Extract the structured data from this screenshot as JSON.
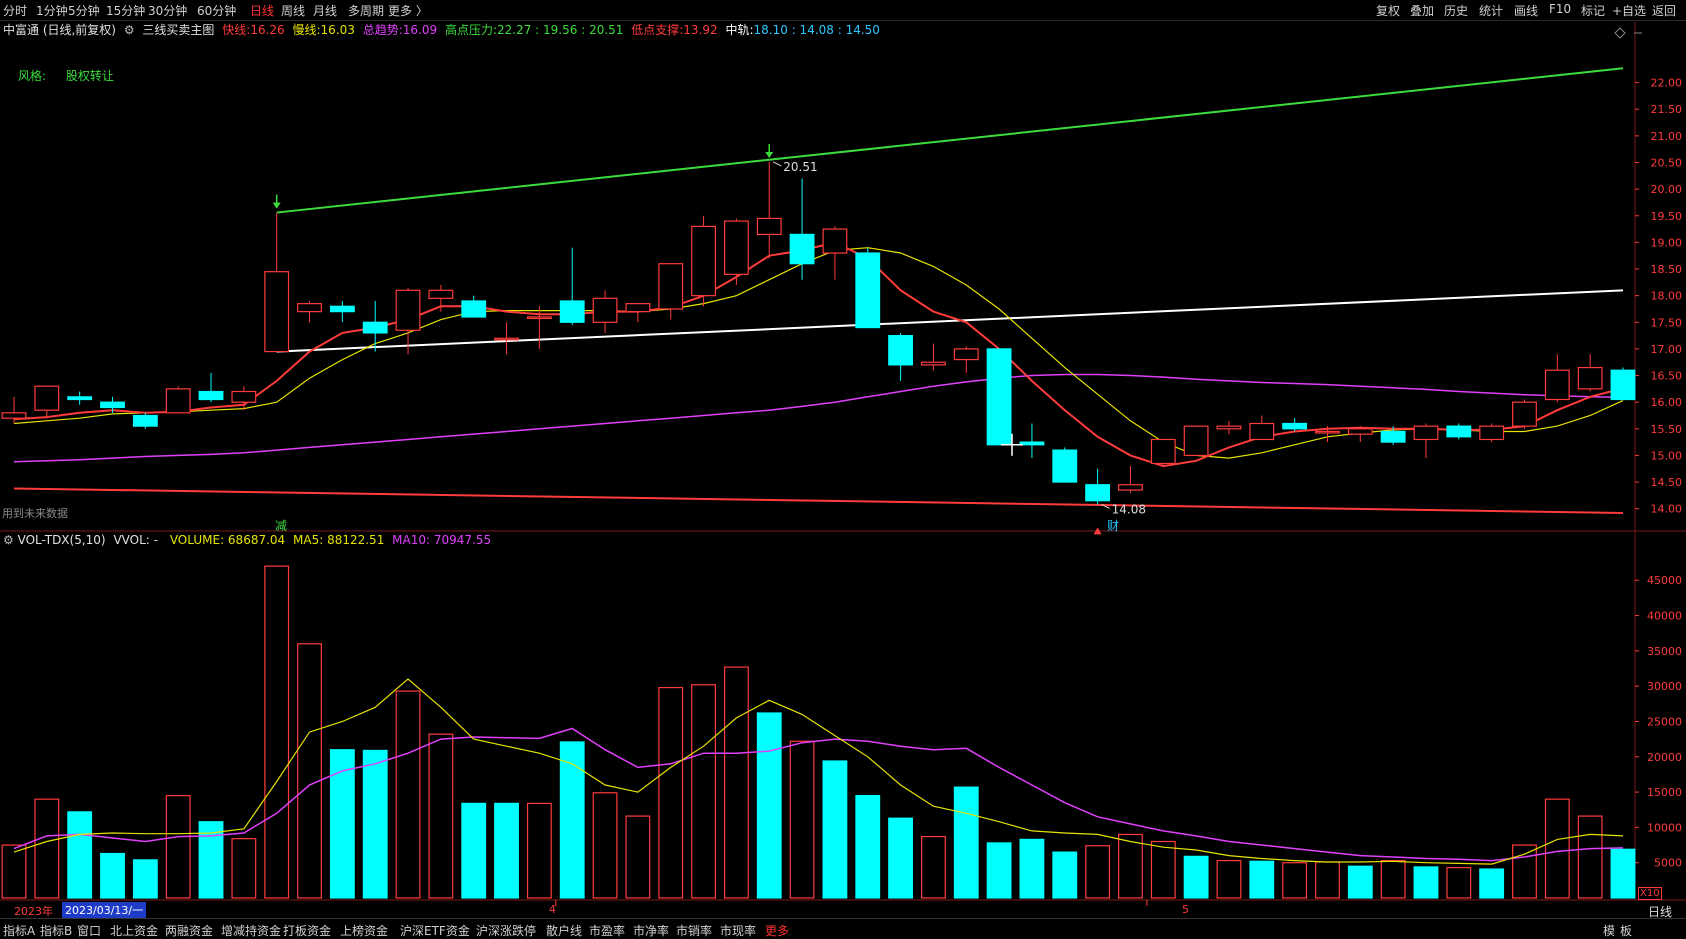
{
  "colors": {
    "up": "#ff3b3b",
    "down": "#00ffff",
    "yellow": "#e5e300",
    "magenta": "#e040fb",
    "green": "#3ddc3d",
    "white": "#ffffff",
    "axis": "#ff3b3b"
  },
  "topbar": {
    "left_tabs": [
      "分时",
      "1分钟",
      "5分钟",
      "15分钟",
      "30分钟",
      "60分钟",
      "日线",
      "周线",
      "月线",
      "多周期",
      "更多 〉"
    ],
    "active_tab": "日线",
    "right_tabs": [
      "复权",
      "叠加",
      "历史",
      "统计",
      "画线",
      "F10",
      "标记",
      "+自选",
      "返回"
    ]
  },
  "infobar": {
    "stock": "中富通 (日线,前复权)",
    "indicator": "三线买卖主图",
    "fast_label": "快线:",
    "fast_value": "16.26",
    "slow_label": "慢线:",
    "slow_value": "16.03",
    "trend_label": "总趋势:",
    "trend_value": "16.09",
    "high_label": "高点压力:",
    "high_values": "22.27 : 19.56 : 20.51",
    "low_label": "低点支撑:",
    "low_value": "13.92",
    "mid_label": "中轨:",
    "mid_values": "18.10 : 14.08 : 14.50"
  },
  "annotations": {
    "style_label": "风格:",
    "style_value": "股权转让",
    "future_data": "用到未来数据",
    "high_mark": "20.51",
    "low_mark": "14.08",
    "event_reduce": "减",
    "event_fin": "财"
  },
  "volbar": {
    "name": "VOL-TDX(5,10)",
    "vvol": "VVOL: -",
    "volume": "VOLUME: 68687.04",
    "ma5": "MA5: 88122.51",
    "ma10": "MA10: 70947.55",
    "multiplier": "X10"
  },
  "datebar": {
    "year": "2023年",
    "date": "2023/03/13/一",
    "m4": "4",
    "m5": "5",
    "period": "日线"
  },
  "bottombar": {
    "tabs": [
      "指标A",
      "指标B",
      "窗口",
      "北上资金",
      "两融资金",
      "增减持资金",
      "打板资金",
      "上榜资金",
      "沪深ETF资金",
      "沪深涨跌停",
      "散户线",
      "市盈率",
      "市净率",
      "市销率",
      "市现率",
      "更多"
    ],
    "active_tab": "更多",
    "right": [
      "模",
      "板"
    ]
  },
  "chart_data": [
    {
      "type": "candlestick",
      "title": "三线买卖主图",
      "ylim": [
        13.6,
        22.8
      ],
      "yticks": [
        14.0,
        14.5,
        15.0,
        15.5,
        16.0,
        16.5,
        17.0,
        17.5,
        18.0,
        18.5,
        19.0,
        19.5,
        20.0,
        20.5,
        21.0,
        21.5,
        22.0
      ],
      "candles": [
        {
          "o": 15.7,
          "h": 16.1,
          "l": 15.6,
          "c": 15.8
        },
        {
          "o": 15.85,
          "h": 16.3,
          "l": 15.7,
          "c": 16.3
        },
        {
          "o": 16.1,
          "h": 16.2,
          "l": 15.95,
          "c": 16.05
        },
        {
          "o": 16.0,
          "h": 16.1,
          "l": 15.8,
          "c": 15.9
        },
        {
          "o": 15.75,
          "h": 15.8,
          "l": 15.5,
          "c": 15.55
        },
        {
          "o": 15.8,
          "h": 16.3,
          "l": 15.8,
          "c": 16.25
        },
        {
          "o": 16.2,
          "h": 16.55,
          "l": 16.0,
          "c": 16.05
        },
        {
          "o": 16.0,
          "h": 16.3,
          "l": 15.85,
          "c": 16.2
        },
        {
          "o": 16.95,
          "h": 19.56,
          "l": 16.95,
          "c": 18.45
        },
        {
          "o": 17.7,
          "h": 17.9,
          "l": 17.5,
          "c": 17.85
        },
        {
          "o": 17.8,
          "h": 17.9,
          "l": 17.5,
          "c": 17.7
        },
        {
          "o": 17.5,
          "h": 17.9,
          "l": 16.95,
          "c": 17.3
        },
        {
          "o": 17.35,
          "h": 18.15,
          "l": 16.9,
          "c": 18.1
        },
        {
          "o": 17.95,
          "h": 18.2,
          "l": 17.7,
          "c": 18.1
        },
        {
          "o": 17.9,
          "h": 18.0,
          "l": 17.6,
          "c": 17.6
        },
        {
          "o": 17.2,
          "h": 17.5,
          "l": 16.9,
          "c": 17.2
        },
        {
          "o": 17.6,
          "h": 17.8,
          "l": 17.0,
          "c": 17.6
        },
        {
          "o": 17.9,
          "h": 18.9,
          "l": 17.45,
          "c": 17.5
        },
        {
          "o": 17.5,
          "h": 18.1,
          "l": 17.3,
          "c": 17.95
        },
        {
          "o": 17.7,
          "h": 17.85,
          "l": 17.5,
          "c": 17.85
        },
        {
          "o": 17.75,
          "h": 18.6,
          "l": 17.55,
          "c": 18.6
        },
        {
          "o": 18.0,
          "h": 19.5,
          "l": 17.8,
          "c": 19.3
        },
        {
          "o": 18.4,
          "h": 19.45,
          "l": 18.2,
          "c": 19.4
        },
        {
          "o": 19.15,
          "h": 20.51,
          "l": 18.7,
          "c": 19.45
        },
        {
          "o": 19.15,
          "h": 20.2,
          "l": 18.3,
          "c": 18.6
        },
        {
          "o": 18.8,
          "h": 19.3,
          "l": 18.3,
          "c": 19.25
        },
        {
          "o": 18.8,
          "h": 18.9,
          "l": 17.4,
          "c": 17.4
        },
        {
          "o": 17.25,
          "h": 17.3,
          "l": 16.4,
          "c": 16.7
        },
        {
          "o": 16.7,
          "h": 17.1,
          "l": 16.6,
          "c": 16.75
        },
        {
          "o": 16.8,
          "h": 17.05,
          "l": 16.55,
          "c": 17.0
        },
        {
          "o": 17.0,
          "h": 17.0,
          "l": 15.2,
          "c": 15.2
        },
        {
          "o": 15.25,
          "h": 15.6,
          "l": 14.95,
          "c": 15.2
        },
        {
          "o": 15.1,
          "h": 15.15,
          "l": 14.5,
          "c": 14.5
        },
        {
          "o": 14.45,
          "h": 14.75,
          "l": 14.08,
          "c": 14.15
        },
        {
          "o": 14.35,
          "h": 14.8,
          "l": 14.3,
          "c": 14.45
        },
        {
          "o": 14.85,
          "h": 15.3,
          "l": 14.8,
          "c": 15.3
        },
        {
          "o": 15.0,
          "h": 15.55,
          "l": 15.0,
          "c": 15.55
        },
        {
          "o": 15.5,
          "h": 15.65,
          "l": 15.4,
          "c": 15.55
        },
        {
          "o": 15.3,
          "h": 15.75,
          "l": 15.3,
          "c": 15.6
        },
        {
          "o": 15.6,
          "h": 15.7,
          "l": 15.45,
          "c": 15.5
        },
        {
          "o": 15.45,
          "h": 15.55,
          "l": 15.25,
          "c": 15.45
        },
        {
          "o": 15.4,
          "h": 15.55,
          "l": 15.25,
          "c": 15.5
        },
        {
          "o": 15.45,
          "h": 15.55,
          "l": 15.2,
          "c": 15.25
        },
        {
          "o": 15.3,
          "h": 15.6,
          "l": 14.95,
          "c": 15.55
        },
        {
          "o": 15.55,
          "h": 15.6,
          "l": 15.3,
          "c": 15.35
        },
        {
          "o": 15.3,
          "h": 15.6,
          "l": 15.25,
          "c": 15.55
        },
        {
          "o": 15.55,
          "h": 16.05,
          "l": 15.5,
          "c": 16.0
        },
        {
          "o": 16.05,
          "h": 16.9,
          "l": 16.0,
          "c": 16.6
        },
        {
          "o": 16.25,
          "h": 16.9,
          "l": 16.2,
          "c": 16.65
        },
        {
          "o": 16.6,
          "h": 16.65,
          "l": 16.05,
          "c": 16.05
        }
      ],
      "fast_line": [
        15.68,
        15.72,
        15.8,
        15.85,
        15.8,
        15.82,
        15.9,
        15.95,
        16.4,
        16.95,
        17.3,
        17.4,
        17.55,
        17.8,
        17.8,
        17.7,
        17.65,
        17.65,
        17.7,
        17.7,
        17.78,
        18.0,
        18.35,
        18.75,
        18.85,
        19.0,
        18.7,
        18.1,
        17.7,
        17.5,
        17.0,
        16.4,
        15.85,
        15.35,
        15.0,
        14.8,
        14.9,
        15.15,
        15.35,
        15.45,
        15.5,
        15.52,
        15.5,
        15.5,
        15.48,
        15.48,
        15.55,
        15.85,
        16.1,
        16.26
      ],
      "slow_line": [
        15.6,
        15.65,
        15.7,
        15.78,
        15.8,
        15.82,
        15.85,
        15.88,
        16.0,
        16.45,
        16.8,
        17.1,
        17.3,
        17.55,
        17.7,
        17.72,
        17.72,
        17.72,
        17.72,
        17.7,
        17.75,
        17.85,
        18.0,
        18.3,
        18.6,
        18.85,
        18.9,
        18.8,
        18.55,
        18.2,
        17.75,
        17.2,
        16.65,
        16.15,
        15.65,
        15.25,
        15.0,
        14.95,
        15.05,
        15.2,
        15.35,
        15.42,
        15.48,
        15.5,
        15.48,
        15.45,
        15.45,
        15.55,
        15.75,
        16.03
      ],
      "trend_line": [
        14.88,
        14.9,
        14.92,
        14.95,
        14.98,
        15.0,
        15.02,
        15.05,
        15.1,
        15.15,
        15.2,
        15.25,
        15.3,
        15.35,
        15.4,
        15.45,
        15.5,
        15.55,
        15.6,
        15.65,
        15.7,
        15.75,
        15.8,
        15.85,
        15.92,
        16.0,
        16.1,
        16.2,
        16.3,
        16.38,
        16.45,
        16.5,
        16.52,
        16.52,
        16.5,
        16.47,
        16.43,
        16.4,
        16.37,
        16.35,
        16.33,
        16.3,
        16.27,
        16.24,
        16.2,
        16.17,
        16.14,
        16.12,
        16.1,
        16.09
      ],
      "resistance_line": {
        "from": [
          8,
          19.56
        ],
        "to": [
          49,
          22.27
        ]
      },
      "mid_line": {
        "from": [
          8,
          16.95
        ],
        "to": [
          49,
          18.1
        ]
      },
      "support_line": {
        "from": [
          0,
          14.38
        ],
        "to": [
          49,
          13.92
        ]
      }
    },
    {
      "type": "bar",
      "title": "VOL-TDX(5,10)",
      "ylim": [
        0,
        49000
      ],
      "yticks": [
        5000,
        10000,
        15000,
        20000,
        25000,
        30000,
        35000,
        40000,
        45000
      ],
      "volumes": [
        7500,
        14000,
        12200,
        6300,
        5400,
        14500,
        10800,
        8400,
        47000,
        36000,
        21000,
        20900,
        29300,
        23200,
        13400,
        13400,
        13400,
        22100,
        14900,
        11600,
        29800,
        30200,
        32700,
        26200,
        22200,
        19400,
        14500,
        11300,
        8700,
        15700,
        7800,
        8300,
        6500,
        7400,
        9000,
        8000,
        5900,
        5300,
        5200,
        5000,
        5100,
        4500,
        5300,
        4400,
        4300,
        4100,
        7500,
        14000,
        11600,
        6900
      ],
      "ma5": [
        6500,
        8000,
        9000,
        9200,
        9100,
        9100,
        9200,
        9800,
        16500,
        23500,
        25000,
        27000,
        31000,
        27000,
        22500,
        21500,
        20500,
        19000,
        16000,
        15000,
        18500,
        21500,
        25500,
        28000,
        26000,
        23000,
        20000,
        16000,
        13000,
        12000,
        10800,
        9500,
        9200,
        9000,
        8000,
        7200,
        6800,
        6000,
        5600,
        5300,
        5100,
        5100,
        5200,
        5000,
        4900,
        4800,
        6200,
        8300,
        9000,
        8800
      ],
      "ma10": [
        7000,
        8800,
        9000,
        8500,
        8000,
        8700,
        8800,
        9200,
        12000,
        16000,
        18000,
        19000,
        20500,
        22500,
        22800,
        22700,
        22600,
        24000,
        21000,
        18500,
        19000,
        20500,
        20500,
        20800,
        22000,
        22500,
        22200,
        21500,
        21000,
        21200,
        18500,
        16000,
        13500,
        11500,
        10500,
        9500,
        8800,
        8000,
        7500,
        7000,
        6500,
        6000,
        5800,
        5600,
        5500,
        5300,
        5800,
        6600,
        7000,
        7100
      ],
      "up": [
        true,
        true,
        false,
        false,
        false,
        true,
        false,
        true,
        true,
        true,
        false,
        false,
        true,
        true,
        false,
        false,
        true,
        false,
        true,
        true,
        true,
        true,
        true,
        false,
        true,
        false,
        false,
        false,
        true,
        false,
        false,
        false,
        false,
        true,
        true,
        true,
        false,
        true,
        false,
        true,
        true,
        false,
        true,
        false,
        true,
        false,
        true,
        true,
        true,
        false
      ]
    }
  ]
}
